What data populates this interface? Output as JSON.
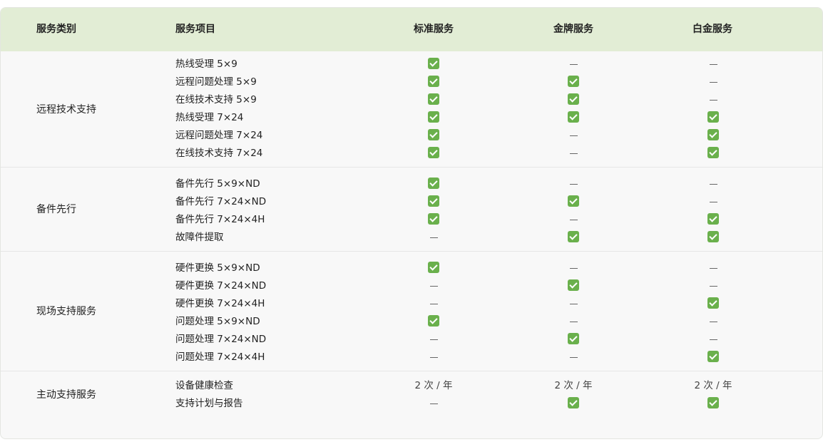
{
  "header": {
    "category": "服务类别",
    "item": "服务项目",
    "standard": "标准服务",
    "gold": "金牌服务",
    "platinum": "白金服务"
  },
  "colors": {
    "header_bg": "#e2edd5",
    "check_green": "#6ab04c",
    "body_bg": "#f8f8f8"
  },
  "icons": {
    "included": "check-icon",
    "not_included": "dash-icon"
  },
  "groups": [
    {
      "category": "远程技术支持",
      "rows": [
        {
          "item": "热线受理 5×9",
          "standard": "check",
          "gold": "dash",
          "platinum": "dash"
        },
        {
          "item": "远程问题处理 5×9",
          "standard": "check",
          "gold": "check",
          "platinum": "dash"
        },
        {
          "item": "在线技术支持 5×9",
          "standard": "check",
          "gold": "check",
          "platinum": "dash"
        },
        {
          "item": "热线受理 7×24",
          "standard": "check",
          "gold": "check",
          "platinum": "check"
        },
        {
          "item": "远程问题处理 7×24",
          "standard": "check",
          "gold": "dash",
          "platinum": "check"
        },
        {
          "item": "在线技术支持 7×24",
          "standard": "check",
          "gold": "dash",
          "platinum": "check"
        }
      ]
    },
    {
      "category": "备件先行",
      "rows": [
        {
          "item": "备件先行 5×9×ND",
          "standard": "check",
          "gold": "dash",
          "platinum": "dash"
        },
        {
          "item": "备件先行 7×24×ND",
          "standard": "check",
          "gold": "check",
          "platinum": "dash"
        },
        {
          "item": "备件先行 7×24×4H",
          "standard": "check",
          "gold": "dash",
          "platinum": "check"
        },
        {
          "item": "故障件提取",
          "standard": "dash",
          "gold": "check",
          "platinum": "check"
        }
      ]
    },
    {
      "category": "现场支持服务",
      "rows": [
        {
          "item": "硬件更换 5×9×ND",
          "standard": "check",
          "gold": "dash",
          "platinum": "dash"
        },
        {
          "item": "硬件更换 7×24×ND",
          "standard": "dash",
          "gold": "check",
          "platinum": "dash"
        },
        {
          "item": "硬件更换 7×24×4H",
          "standard": "dash",
          "gold": "dash",
          "platinum": "check"
        },
        {
          "item": "问题处理 5×9×ND",
          "standard": "check",
          "gold": "dash",
          "platinum": "dash"
        },
        {
          "item": "问题处理 7×24×ND",
          "standard": "dash",
          "gold": "check",
          "platinum": "dash"
        },
        {
          "item": "问题处理 7×24×4H",
          "standard": "dash",
          "gold": "dash",
          "platinum": "check"
        }
      ]
    },
    {
      "category": "主动支持服务",
      "rows": [
        {
          "item": "设备健康检查",
          "standard": "2 次 / 年",
          "gold": "2 次 / 年",
          "platinum": "2 次 / 年"
        },
        {
          "item": "支持计划与报告",
          "standard": "dash",
          "gold": "check",
          "platinum": "check"
        }
      ]
    }
  ]
}
